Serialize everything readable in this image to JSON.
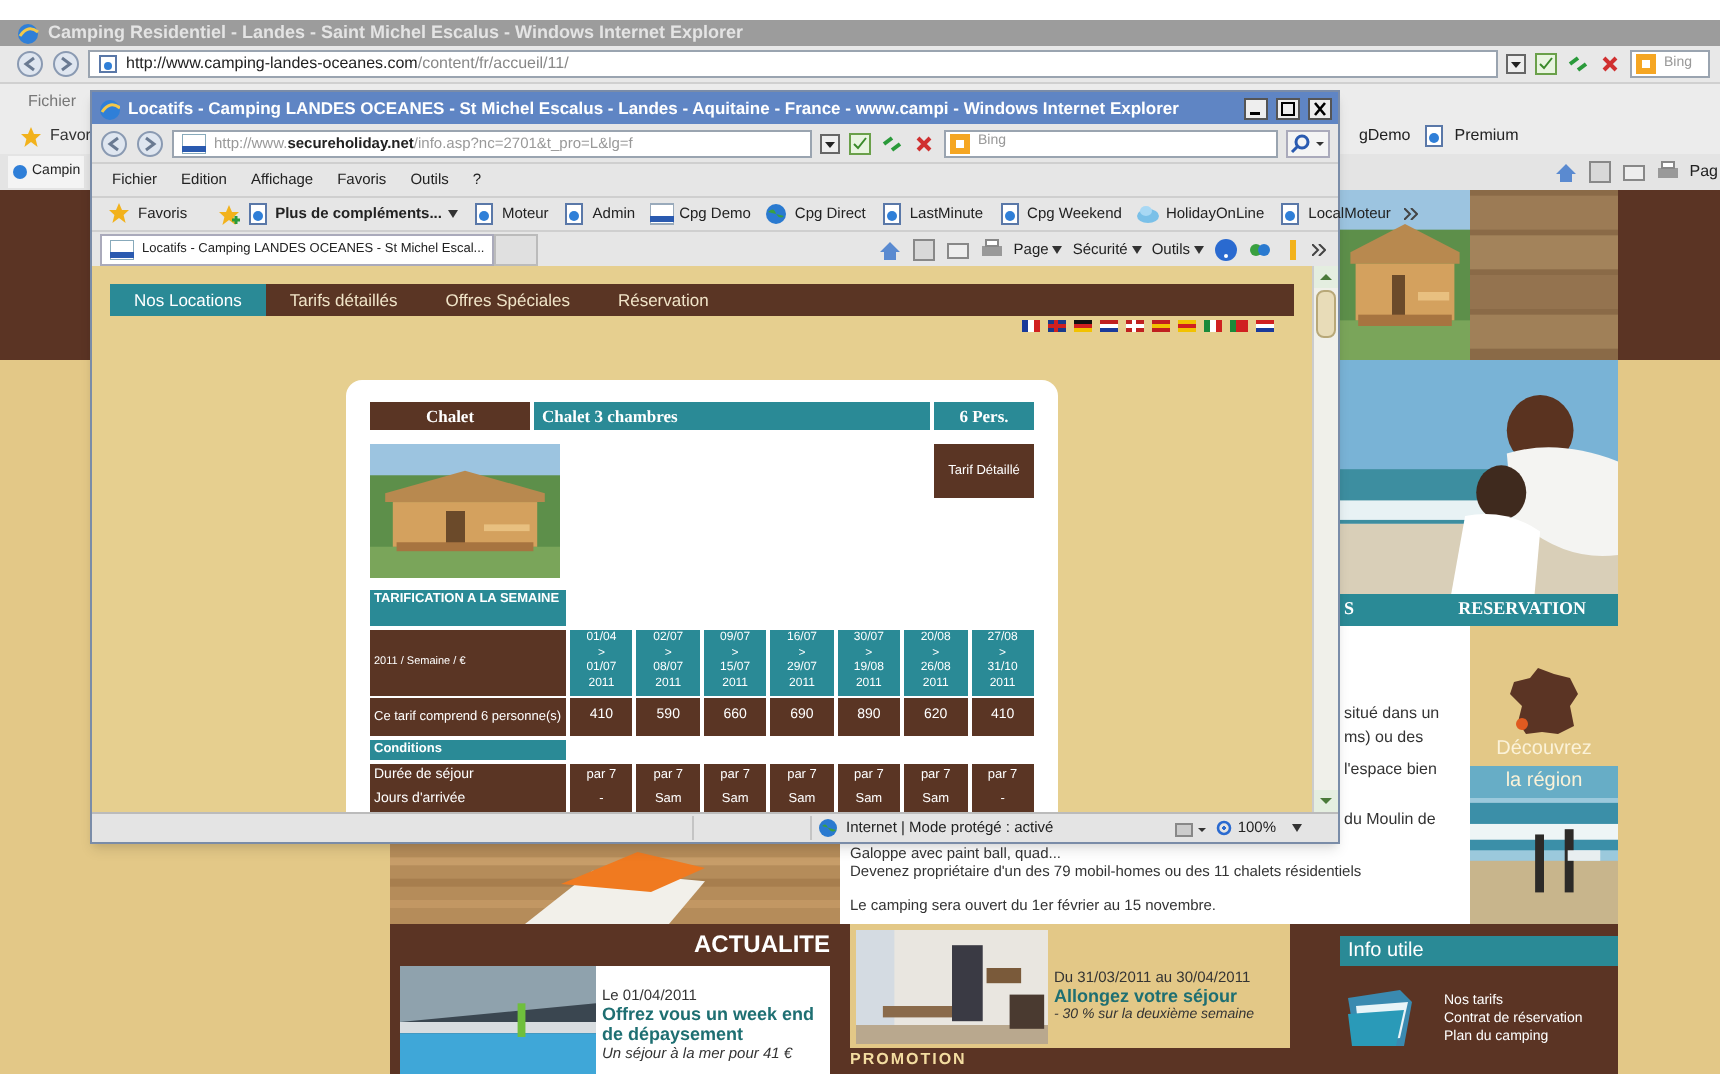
{
  "outer_window": {
    "title": "Camping Residentiel - Landes - Saint Michel Escalus - Windows Internet Explorer",
    "address_host": "http://www.camping-landes-oceanes.com",
    "address_path": "/content/fr/accueil/11/",
    "search_placeholder": "Bing",
    "menu_fragment": "Fichier",
    "favorites_fragment": "Favor",
    "favorites_right": [
      "gDemo",
      "Premium"
    ],
    "tab_fragment": "Campin",
    "command_fragment": "Pag"
  },
  "background_page": {
    "nav_fragments": [
      "S",
      "RESERVATION"
    ],
    "text_fragments": [
      "situé dans un",
      "ms) ou des",
      "l'espace bien",
      "du Moulin de"
    ],
    "text_lines": [
      "Galoppe avec paint ball, quad...",
      "Devenez propriétaire d'un des 79 mobil-homes ou des 11 chalets résidentiels",
      "Le camping sera ouvert du 1er février au 15 novembre."
    ],
    "discover": [
      "Découvrez",
      "la région"
    ],
    "news": {
      "title": "ACTUALITE",
      "date": "Le 01/04/2011",
      "headline": "Offrez vous un week end de dépaysement",
      "teaser": "Un séjour à la mer pour 41 €"
    },
    "promo": {
      "dates": "Du 31/03/2011 au 30/04/2011",
      "headline": "Allongez votre séjour",
      "teaser": "- 30 % sur la deuxième semaine",
      "label": "PROMOTION"
    },
    "info": {
      "title": "Info utile",
      "links": [
        "Nos tarifs",
        "Contrat de réservation",
        "Plan du camping"
      ]
    }
  },
  "popup_window": {
    "title": "Locatifs - Camping LANDES OCEANES - St Michel Escalus - Landes - Aquitaine - France - www.campi - Windows Internet Explorer",
    "address_prefix": "http://www.",
    "address_host": "secureholiday.net",
    "address_path": "/info.asp?nc=2701&t_pro=L&lg=f",
    "search_placeholder": "Bing",
    "menu": [
      "Fichier",
      "Edition",
      "Affichage",
      "Favoris",
      "Outils",
      "?"
    ],
    "favorites": [
      {
        "label": "Favoris",
        "kind": "star"
      },
      {
        "label": "Plus de compléments...",
        "kind": "addon"
      },
      {
        "label": "Moteur",
        "kind": "page"
      },
      {
        "label": "Admin",
        "kind": "page"
      },
      {
        "label": "Cpg Demo",
        "kind": "stripe"
      },
      {
        "label": "Cpg Direct",
        "kind": "globe"
      },
      {
        "label": "LastMinute",
        "kind": "page"
      },
      {
        "label": "Cpg Weekend",
        "kind": "page"
      },
      {
        "label": "HolidayOnLine",
        "kind": "cloud"
      },
      {
        "label": "LocalMoteur",
        "kind": "page"
      }
    ],
    "tab": "Locatifs - Camping LANDES OCEANES - St Michel Escal...",
    "command_bar": [
      "Page",
      "Sécurité",
      "Outils"
    ],
    "status": "Internet | Mode protégé : activé",
    "zoom": "100%",
    "page": {
      "nav": [
        {
          "label": "Nos Locations",
          "selected": true
        },
        {
          "label": "Tarifs détaillés",
          "selected": false
        },
        {
          "label": "Offres Spéciales",
          "selected": false
        },
        {
          "label": "Réservation",
          "selected": false
        }
      ],
      "card": {
        "type": "Chalet",
        "name": "Chalet 3 chambres",
        "capacity": "6 Pers.",
        "detail_button": "Tarif Détaillé",
        "table_title": "TARIFICATION A LA SEMAINE",
        "period_label": "2011 / Semaine / €",
        "periods": [
          "01/04\n>\n01/07\n2011",
          "02/07\n>\n08/07\n2011",
          "09/07\n>\n15/07\n2011",
          "16/07\n>\n29/07\n2011",
          "30/07\n>\n19/08\n2011",
          "20/08\n>\n26/08\n2011",
          "27/08\n>\n31/10\n2011"
        ],
        "price_label": "Ce tarif comprend 6 personne(s)",
        "prices": [
          "410",
          "590",
          "660",
          "690",
          "890",
          "620",
          "410"
        ],
        "conditions_title": "Conditions",
        "conditions": [
          {
            "label": "Durée de séjour",
            "values": [
              "par 7",
              "par 7",
              "par 7",
              "par 7",
              "par 7",
              "par 7",
              "par 7"
            ]
          },
          {
            "label": "Jours d'arrivée",
            "values": [
              "-",
              "Sam",
              "Sam",
              "Sam",
              "Sam",
              "Sam",
              "-"
            ]
          }
        ]
      }
    }
  }
}
